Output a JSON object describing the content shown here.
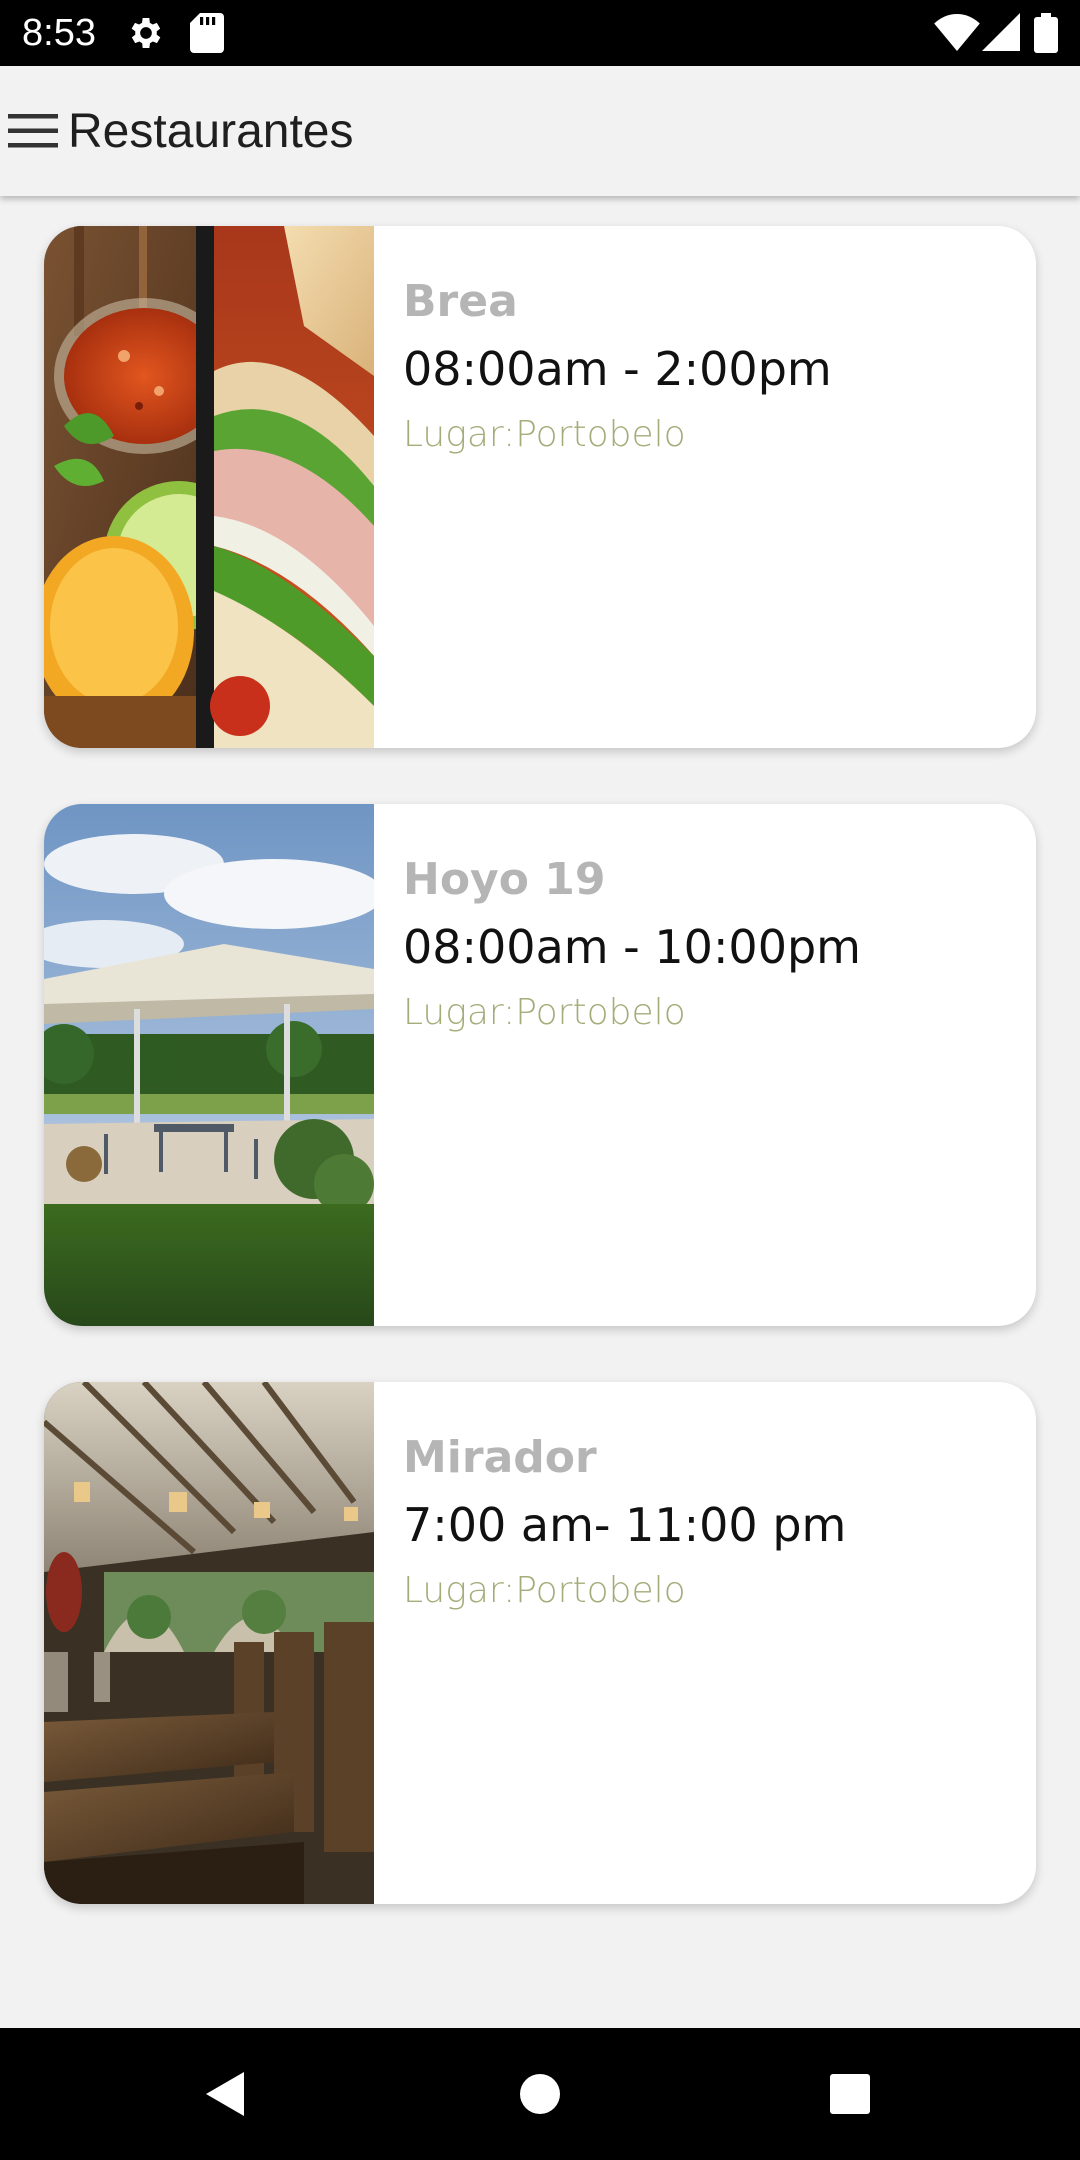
{
  "status_bar": {
    "time": "8:53",
    "icons": [
      "settings-icon",
      "sd-card-icon",
      "wifi-icon",
      "signal-icon",
      "battery-icon"
    ]
  },
  "app_bar": {
    "title": "Restaurantes",
    "menu_icon": "menu-icon"
  },
  "restaurants": [
    {
      "name": "Brea",
      "hours": "08:00am - 2:00pm",
      "place": "Lugar:Portobelo",
      "image": "food-salsa-sandwich"
    },
    {
      "name": "Hoyo 19",
      "hours": "08:00am - 10:00pm",
      "place": "Lugar:Portobelo",
      "image": "outdoor-terrace"
    },
    {
      "name": "Mirador",
      "hours": "7:00 am- 11:00 pm",
      "place": "Lugar:Portobelo",
      "image": "dining-hall"
    }
  ],
  "nav_bar": {
    "icons": [
      "back-icon",
      "home-icon",
      "recents-icon"
    ]
  },
  "colors": {
    "name": "#b5b5b5",
    "hours": "#111111",
    "place": "#a3ad7a",
    "background": "#f2f2f2"
  }
}
